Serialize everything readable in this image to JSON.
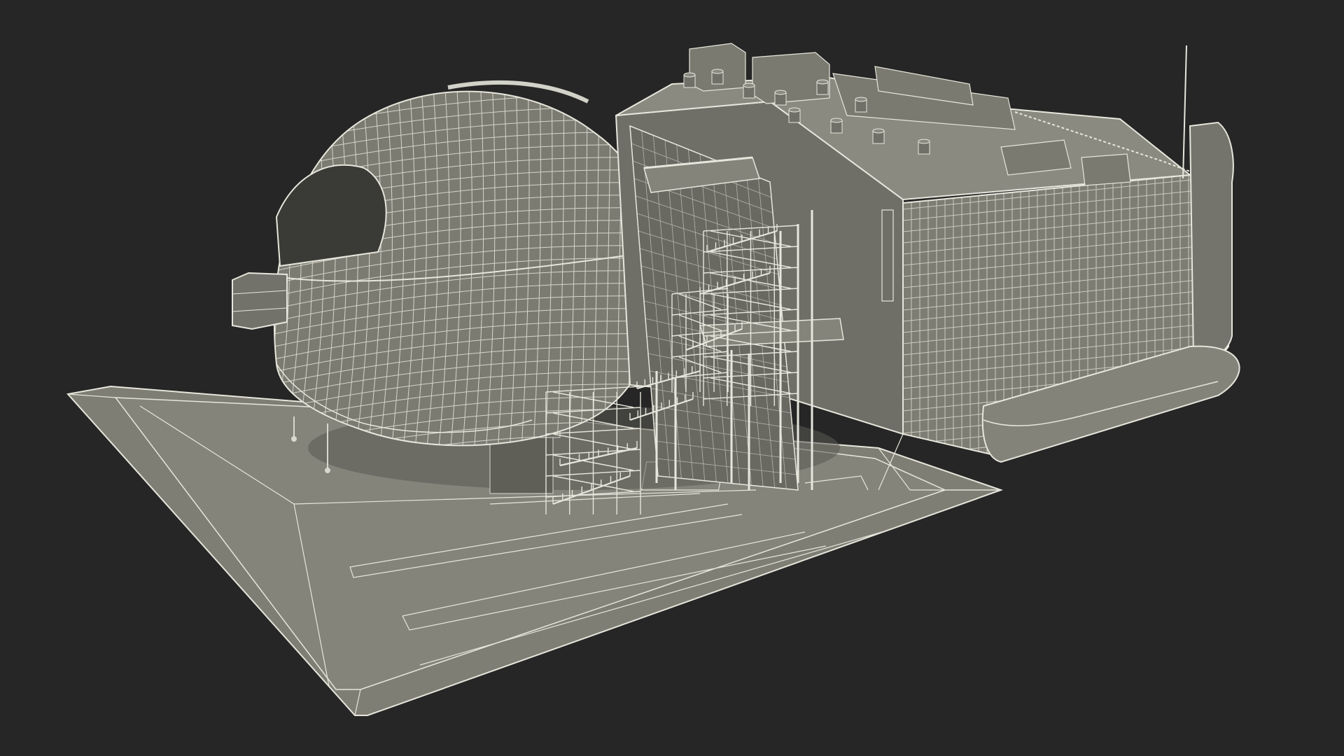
{
  "scene": {
    "subject": "wireframe-3d-render",
    "colors": {
      "background": "#262626",
      "surface": "#7b7b72",
      "surface_light": "#8e8e85",
      "surface_dark": "#5f5f58",
      "shadow": "#3a3a36",
      "wire": "#e6e6dc",
      "wire_dim": "#c9c9bf"
    }
  }
}
